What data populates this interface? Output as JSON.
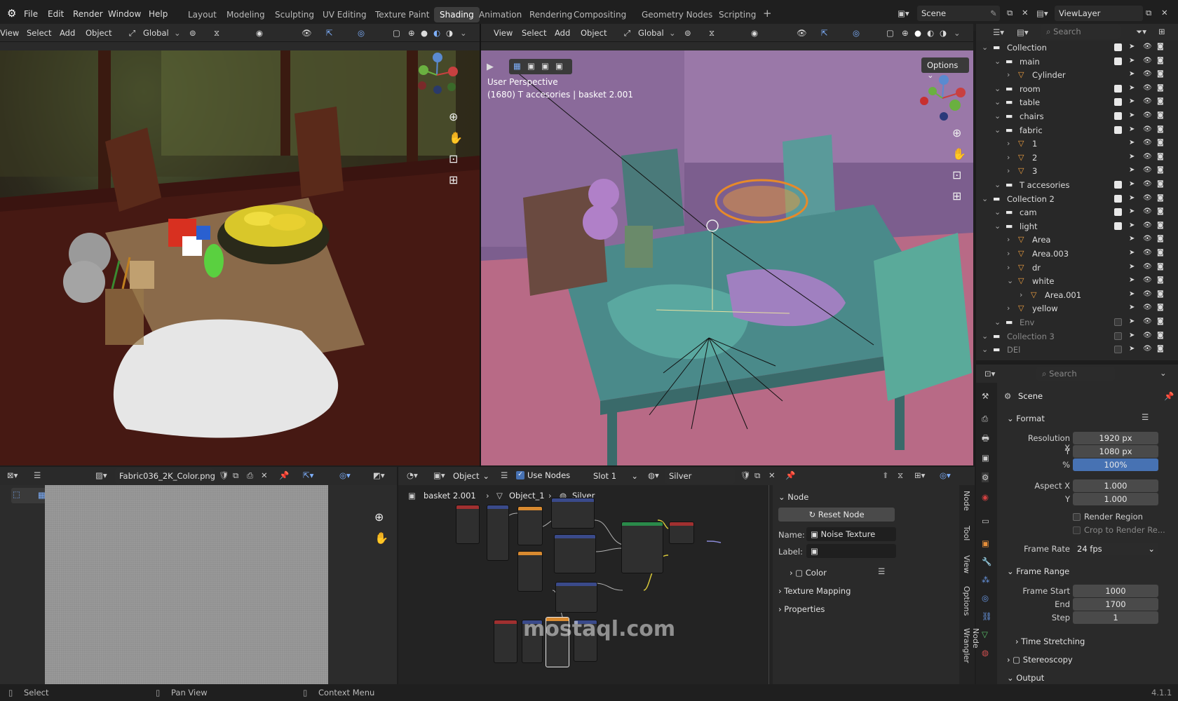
{
  "menu": [
    "File",
    "Edit",
    "Render",
    "Window",
    "Help"
  ],
  "workspaces": [
    "Layout",
    "Modeling",
    "Sculpting",
    "UV Editing",
    "Texture Paint",
    "Shading",
    "Animation",
    "Rendering",
    "Compositing",
    "Geometry Nodes",
    "Scripting"
  ],
  "active_workspace": "Shading",
  "scene": "Scene",
  "view_layer": "ViewLayer",
  "left_view": {
    "menus": [
      "View",
      "Select",
      "Add",
      "Object"
    ],
    "orientation": "Global"
  },
  "right_view": {
    "menus": [
      "View",
      "Select",
      "Add",
      "Object"
    ],
    "orientation": "Global",
    "options": "Options",
    "perspective": "User Perspective",
    "info": "(1680) T accesories | basket 2.001"
  },
  "outliner": {
    "search": "Search",
    "rows": [
      {
        "label": "Collection",
        "indent": 0
      },
      {
        "label": "main",
        "indent": 1
      },
      {
        "label": "Cylinder",
        "indent": 2
      },
      {
        "label": "room",
        "indent": 1
      },
      {
        "label": "table",
        "indent": 1
      },
      {
        "label": "chairs",
        "indent": 1
      },
      {
        "label": "fabric",
        "indent": 1
      },
      {
        "label": "1",
        "indent": 2
      },
      {
        "label": "2",
        "indent": 2
      },
      {
        "label": "3",
        "indent": 2
      },
      {
        "label": "T accesories",
        "indent": 1
      },
      {
        "label": "Collection 2",
        "indent": 0
      },
      {
        "label": "cam",
        "indent": 1
      },
      {
        "label": "light",
        "indent": 1
      },
      {
        "label": "Area",
        "indent": 2
      },
      {
        "label": "Area.003",
        "indent": 2
      },
      {
        "label": "dr",
        "indent": 2
      },
      {
        "label": "white",
        "indent": 2
      },
      {
        "label": "Area.001",
        "indent": 3
      },
      {
        "label": "yellow",
        "indent": 2
      },
      {
        "label": "Env",
        "indent": 1
      },
      {
        "label": "Collection 3",
        "indent": 0
      },
      {
        "label": "DEl",
        "indent": 0
      }
    ]
  },
  "props": {
    "search": "Search",
    "context": "Scene",
    "format": "Format",
    "res_x_label": "Resolution X",
    "res_x": "1920 px",
    "res_y_label": "Y",
    "res_y": "1080 px",
    "pct_label": "%",
    "pct": "100%",
    "aspect_x_label": "Aspect X",
    "aspect_x": "1.000",
    "aspect_y_label": "Y",
    "aspect_y": "1.000",
    "render_region": "Render Region",
    "crop": "Crop to Render Re...",
    "frame_rate_label": "Frame Rate",
    "frame_rate": "24 fps",
    "frame_range": "Frame Range",
    "start_label": "Frame Start",
    "start": "1000",
    "end_label": "End",
    "end": "1700",
    "step_label": "Step",
    "step": "1",
    "time_stretching": "Time Stretching",
    "stereoscopy": "Stereoscopy",
    "output": "Output"
  },
  "image_editor": {
    "file": "Fabric036_2K_Color.png"
  },
  "node_editor": {
    "object": "Object",
    "use_nodes": "Use Nodes",
    "slot": "Slot 1",
    "material": "Silver",
    "breadcrumb": [
      "basket 2.001",
      "Object_1",
      "Silver"
    ],
    "panel": {
      "title": "Node",
      "reset": "Reset Node",
      "name_label": "Name:",
      "name": "Noise Texture",
      "label_label": "Label:",
      "color": "Color",
      "texture_mapping": "Texture Mapping",
      "properties": "Properties"
    },
    "tabs": [
      "Node",
      "Tool",
      "View",
      "Options",
      "Node Wrangler"
    ]
  },
  "status": {
    "select": "Select",
    "pan": "Pan View",
    "context": "Context Menu",
    "version": "4.1.1"
  },
  "watermark": "mostaql.com"
}
